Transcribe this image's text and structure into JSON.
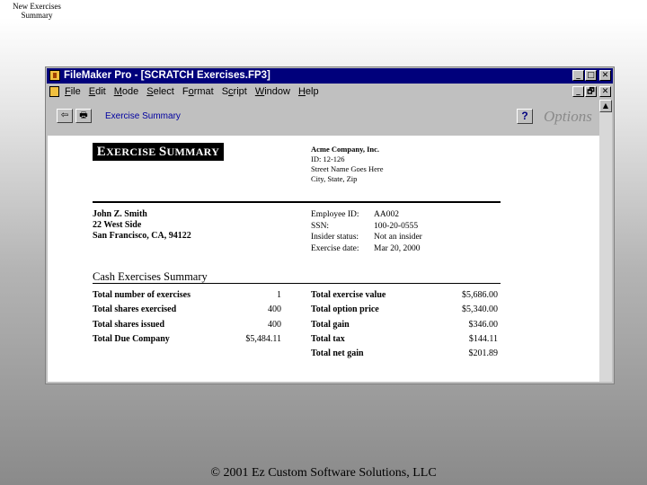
{
  "slide": {
    "title": "New Exercises Summary",
    "footer": "© 2001 Ez Custom Software Solutions, LLC"
  },
  "window": {
    "title": "FileMaker Pro - [SCRATCH Exercises.FP3]",
    "controls": {
      "minimize": "_",
      "maximize": "□",
      "restore": "🗗",
      "close": "✕"
    }
  },
  "menubar": {
    "items": [
      "File",
      "Edit",
      "Mode",
      "Select",
      "Format",
      "Script",
      "Window",
      "Help"
    ],
    "accelerators": [
      "F",
      "E",
      "M",
      "S",
      "o",
      "c",
      "W",
      "H"
    ]
  },
  "toolbar": {
    "back_icon": "⇦",
    "print_icon": "🖶",
    "link": "Exercise Summary",
    "help": "?",
    "options": "Options"
  },
  "document": {
    "title_first_big": "E",
    "title_rest1": "XERCISE ",
    "title_second_big": "S",
    "title_rest2": "UMMARY",
    "company": {
      "name": "Acme Company, Inc.",
      "id": "ID: 12-126",
      "street": "Street Name Goes Here",
      "city": "City, State, Zip"
    },
    "person": {
      "name": "John Z. Smith",
      "address1": "22 West Side",
      "address2": "San Francisco, CA, 94122"
    },
    "employee": {
      "labels": [
        "Employee ID:",
        "SSN:",
        "Insider status:",
        "Exercise date:"
      ],
      "values": [
        "AA002",
        "100-20-0555",
        "Not an insider",
        "Mar 20, 2000"
      ]
    },
    "section_title": "Cash Exercises Summary",
    "left_summary": [
      {
        "label": "Total number of exercises",
        "value": "1"
      },
      {
        "label": "Total shares exercised",
        "value": "400"
      },
      {
        "label": "Total shares issued",
        "value": "400"
      },
      {
        "label": "Total Due Company",
        "value": "$5,484.11"
      }
    ],
    "right_summary": [
      {
        "label": "Total exercise value",
        "value": "$5,686.00"
      },
      {
        "label": "Total option price",
        "value": "$5,340.00"
      },
      {
        "label": "Total gain",
        "value": "$346.00"
      },
      {
        "label": "Total tax",
        "value": "$144.11"
      },
      {
        "label": "Total net gain",
        "value": "$201.89"
      }
    ]
  },
  "scrollbar": {
    "up_arrow": "▲"
  }
}
